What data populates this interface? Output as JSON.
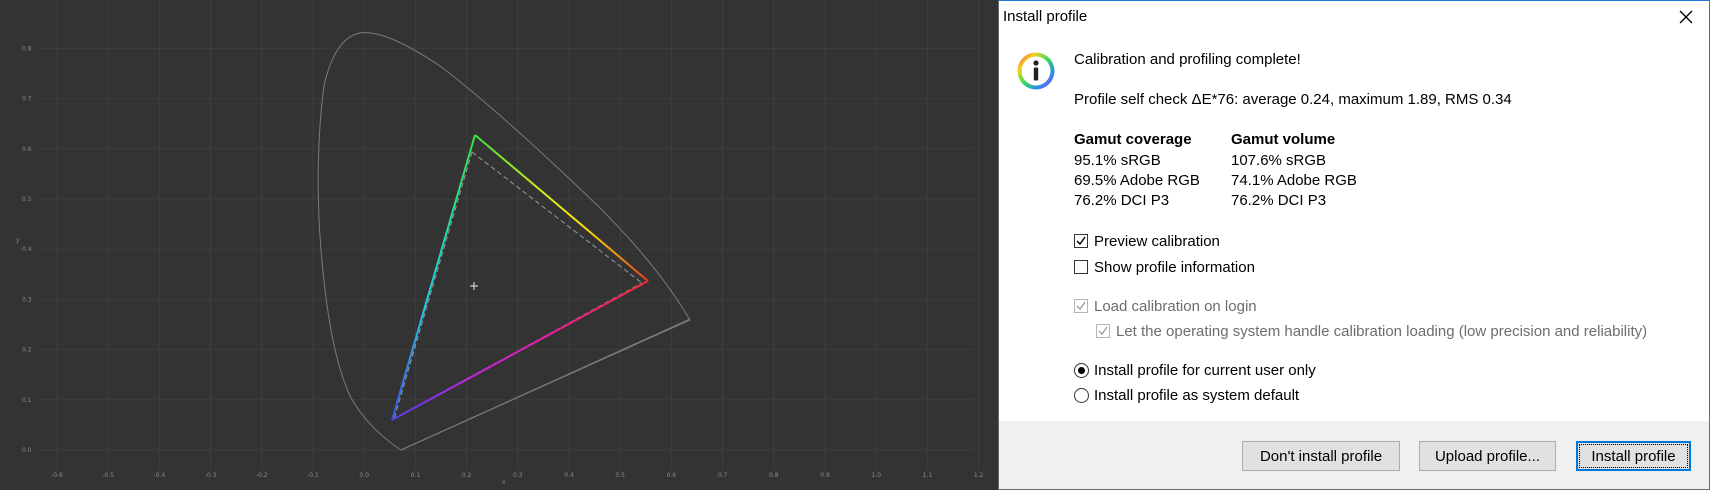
{
  "chart": {
    "x_axis_label": "x",
    "y_axis_label": "y",
    "x_ticks": [
      "-0.6",
      "-0.5",
      "-0.4",
      "-0.3",
      "-0.2",
      "-0.1",
      "0.0",
      "0.1",
      "0.2",
      "0.3",
      "0.4",
      "0.5",
      "0.6",
      "0.7",
      "0.8",
      "0.9",
      "1.0",
      "1.1",
      "1.2"
    ],
    "y_ticks": [
      "0.0",
      "0.1",
      "0.2",
      "0.3",
      "0.4",
      "0.5",
      "0.6",
      "0.7",
      "0.8"
    ],
    "colors": {
      "background": "#333333",
      "grid": "#3d3d3d",
      "locus": "#7a7a7a"
    }
  },
  "dialog": {
    "title": "Install profile",
    "heading": "Calibration and profiling complete!",
    "self_check": "Profile self check ΔE*76: average 0.24, maximum 1.89, RMS 0.34",
    "gamut_coverage": {
      "title": "Gamut coverage",
      "items": [
        "95.1% sRGB",
        "69.5% Adobe RGB",
        "76.2% DCI P3"
      ]
    },
    "gamut_volume": {
      "title": "Gamut volume",
      "items": [
        "107.6% sRGB",
        "74.1% Adobe RGB",
        "76.2% DCI P3"
      ]
    },
    "options": {
      "preview_calibration": {
        "label": "Preview calibration",
        "checked": true,
        "enabled": true
      },
      "show_profile_information": {
        "label": "Show profile information",
        "checked": false,
        "enabled": true
      },
      "load_calibration_on_login": {
        "label": "Load calibration on login",
        "checked": true,
        "enabled": false
      },
      "os_handle_calibration": {
        "label": "Let the operating system handle calibration loading (low precision and reliability)",
        "checked": true,
        "enabled": false
      }
    },
    "install_scope": {
      "selected": "current_user",
      "current_user_label": "Install profile for current user only",
      "system_default_label": "Install profile as system default"
    },
    "buttons": {
      "dont_install": "Don't install profile",
      "upload": "Upload profile...",
      "install": "Install profile"
    }
  }
}
